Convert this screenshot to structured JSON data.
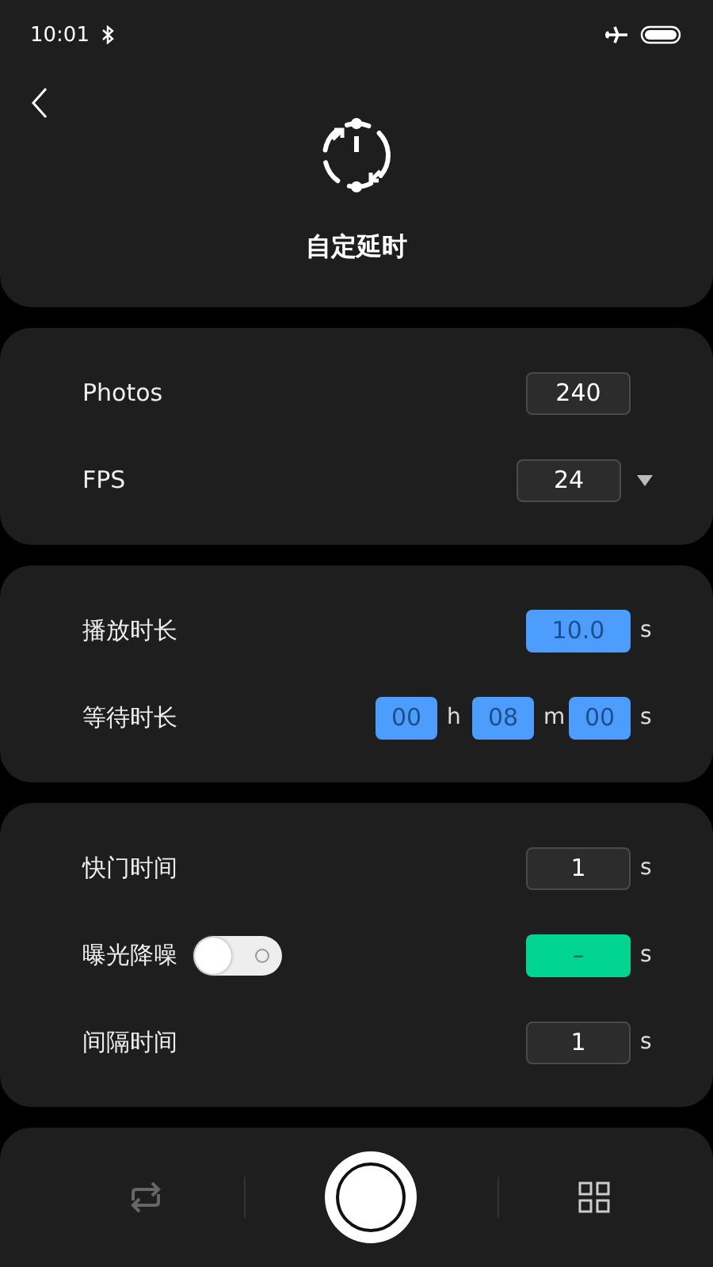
{
  "status_bar": {
    "time": "10:01"
  },
  "header": {
    "title": "自定延时"
  },
  "sections": [
    {
      "rows": [
        {
          "label": "Photos",
          "fields": [
            {
              "value": "240",
              "kind": "dark"
            }
          ]
        },
        {
          "label": "FPS",
          "fields": [
            {
              "value": "24",
              "kind": "dark"
            }
          ],
          "dropdown": true
        }
      ]
    },
    {
      "rows": [
        {
          "label": "播放时长",
          "fields": [
            {
              "value": "10.0",
              "kind": "blue",
              "unit": "s"
            }
          ]
        },
        {
          "label": "等待时长",
          "fields": [
            {
              "value": "00",
              "kind": "blue-small",
              "unit": "h"
            },
            {
              "value": "08",
              "kind": "blue-small",
              "unit": "m"
            },
            {
              "value": "00",
              "kind": "blue-small",
              "unit": "s"
            }
          ]
        }
      ]
    },
    {
      "rows": [
        {
          "label": "快门时间",
          "fields": [
            {
              "value": "1",
              "kind": "dark",
              "unit": "s"
            }
          ]
        },
        {
          "label": "曝光降噪",
          "toggle": {
            "on": false
          },
          "fields": [
            {
              "value": "–",
              "kind": "green",
              "unit": "s"
            }
          ]
        },
        {
          "label": "间隔时间",
          "fields": [
            {
              "value": "1",
              "kind": "dark",
              "unit": "s"
            }
          ]
        }
      ]
    }
  ]
}
